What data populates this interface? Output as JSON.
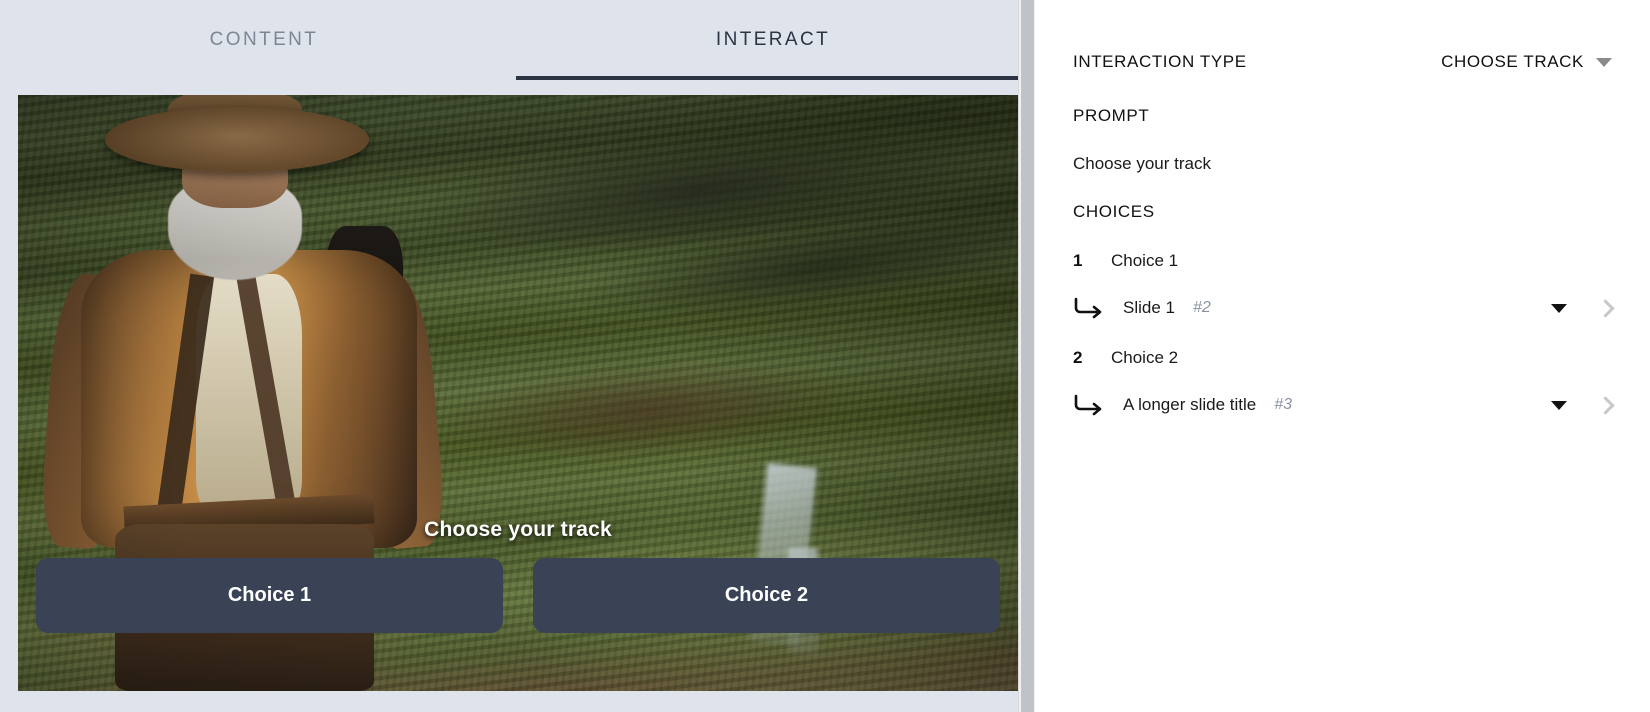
{
  "tabs": [
    {
      "label": "CONTENT",
      "active": false
    },
    {
      "label": "INTERACT",
      "active": true
    }
  ],
  "preview": {
    "prompt_overlay": "Choose your track",
    "buttons": [
      {
        "label": "Choice 1"
      },
      {
        "label": "Choice 2"
      }
    ]
  },
  "inspector": {
    "interaction_type_label": "INTERACTION TYPE",
    "interaction_type_value": "CHOOSE TRACK",
    "prompt_label": "PROMPT",
    "prompt_value": "Choose your track",
    "choices_label": "CHOICES",
    "choices": [
      {
        "number": "1",
        "label": "Choice 1",
        "target_title": "Slide 1",
        "target_ref": "#2"
      },
      {
        "number": "2",
        "label": "Choice 2",
        "target_title": "A longer slide title",
        "target_ref": "#3"
      }
    ]
  },
  "colors": {
    "tabbar_bg": "#dfe4ec",
    "tab_active_underline": "#2c3444",
    "tab_inactive_text": "#7d8694",
    "overlay_button_bg": "#3a4256",
    "ref_text": "#8a93a3",
    "chevron": "#c8c8c8"
  }
}
